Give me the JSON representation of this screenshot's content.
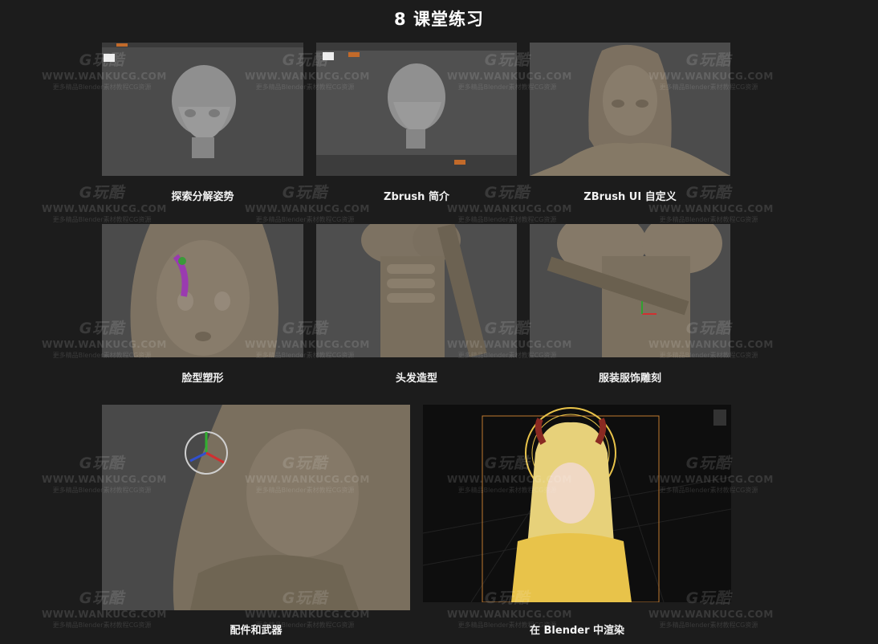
{
  "title": "8 课堂练习",
  "captions": {
    "c1": "探索分解姿势",
    "c2": "Zbrush 简介",
    "c3": "ZBrush UI 自定义",
    "c4": "脸型塑形",
    "c5": "头发造型",
    "c6": "服装服饰雕刻",
    "c7": "配件和武器",
    "c8": "在 Blender 中渲染"
  },
  "watermark": {
    "logo": "G玩酷",
    "url": "WWW.WANKUCG.COM",
    "sub": "更多精品Blender素材教程CG资源"
  },
  "colors": {
    "page_background": "#1c1c1c",
    "viewport_gray": "#4a4a4a",
    "clay": "#7d7262",
    "halo_gold": "#e8c34a"
  }
}
